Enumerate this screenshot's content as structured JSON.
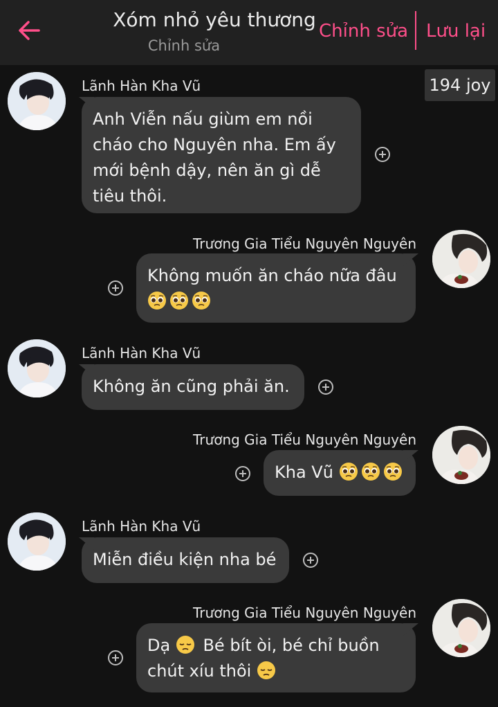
{
  "header": {
    "title": "Xóm nhỏ yêu thương",
    "subtitle": "Chỉnh sửa",
    "edit_label": "Chỉnh sửa",
    "save_label": "Lưu lại",
    "back_icon": "back-arrow-icon",
    "accent_color": "#ff4f8a"
  },
  "joy_badge": "194 joy",
  "messages": [
    {
      "sender": "Lãnh Hàn Kha Vũ",
      "text": "Anh Viễn nấu giùm em nồi cháo cho Nguyên nha. Em ấy mới bệnh dậy, nên ăn gì dễ tiêu thôi.",
      "side": "left"
    },
    {
      "sender": "Trương Gia Tiểu Nguyên Nguyên",
      "text": "Không muốn ăn cháo nữa đâu",
      "emoji": "pleading-face-icon ×3",
      "side": "right"
    },
    {
      "sender": "Lãnh Hàn Kha Vũ",
      "text": "Không ăn cũng phải ăn.",
      "side": "left"
    },
    {
      "sender": "Trương Gia Tiểu Nguyên Nguyên",
      "text": "Kha Vũ",
      "emoji": "pleading-face-icon ×3",
      "side": "right"
    },
    {
      "sender": "Lãnh Hàn Kha Vũ",
      "text": "Miễn điều kiện nha bé",
      "side": "left"
    },
    {
      "sender": "Trương Gia Tiểu Nguyên Nguyên",
      "line1_a": "Dạ",
      "line1_b": "Bé bít òi, bé chỉ buồn",
      "line2": "chút xíu thôi",
      "emoji": "disappointed-face-icon",
      "side": "right"
    }
  ],
  "msg1_lines": [
    "Anh Viễn nấu giùm em nồi",
    "cháo cho Nguyên nha. Em ấy",
    "mới bệnh dậy, nên ăn gì dễ",
    "tiêu thôi."
  ]
}
